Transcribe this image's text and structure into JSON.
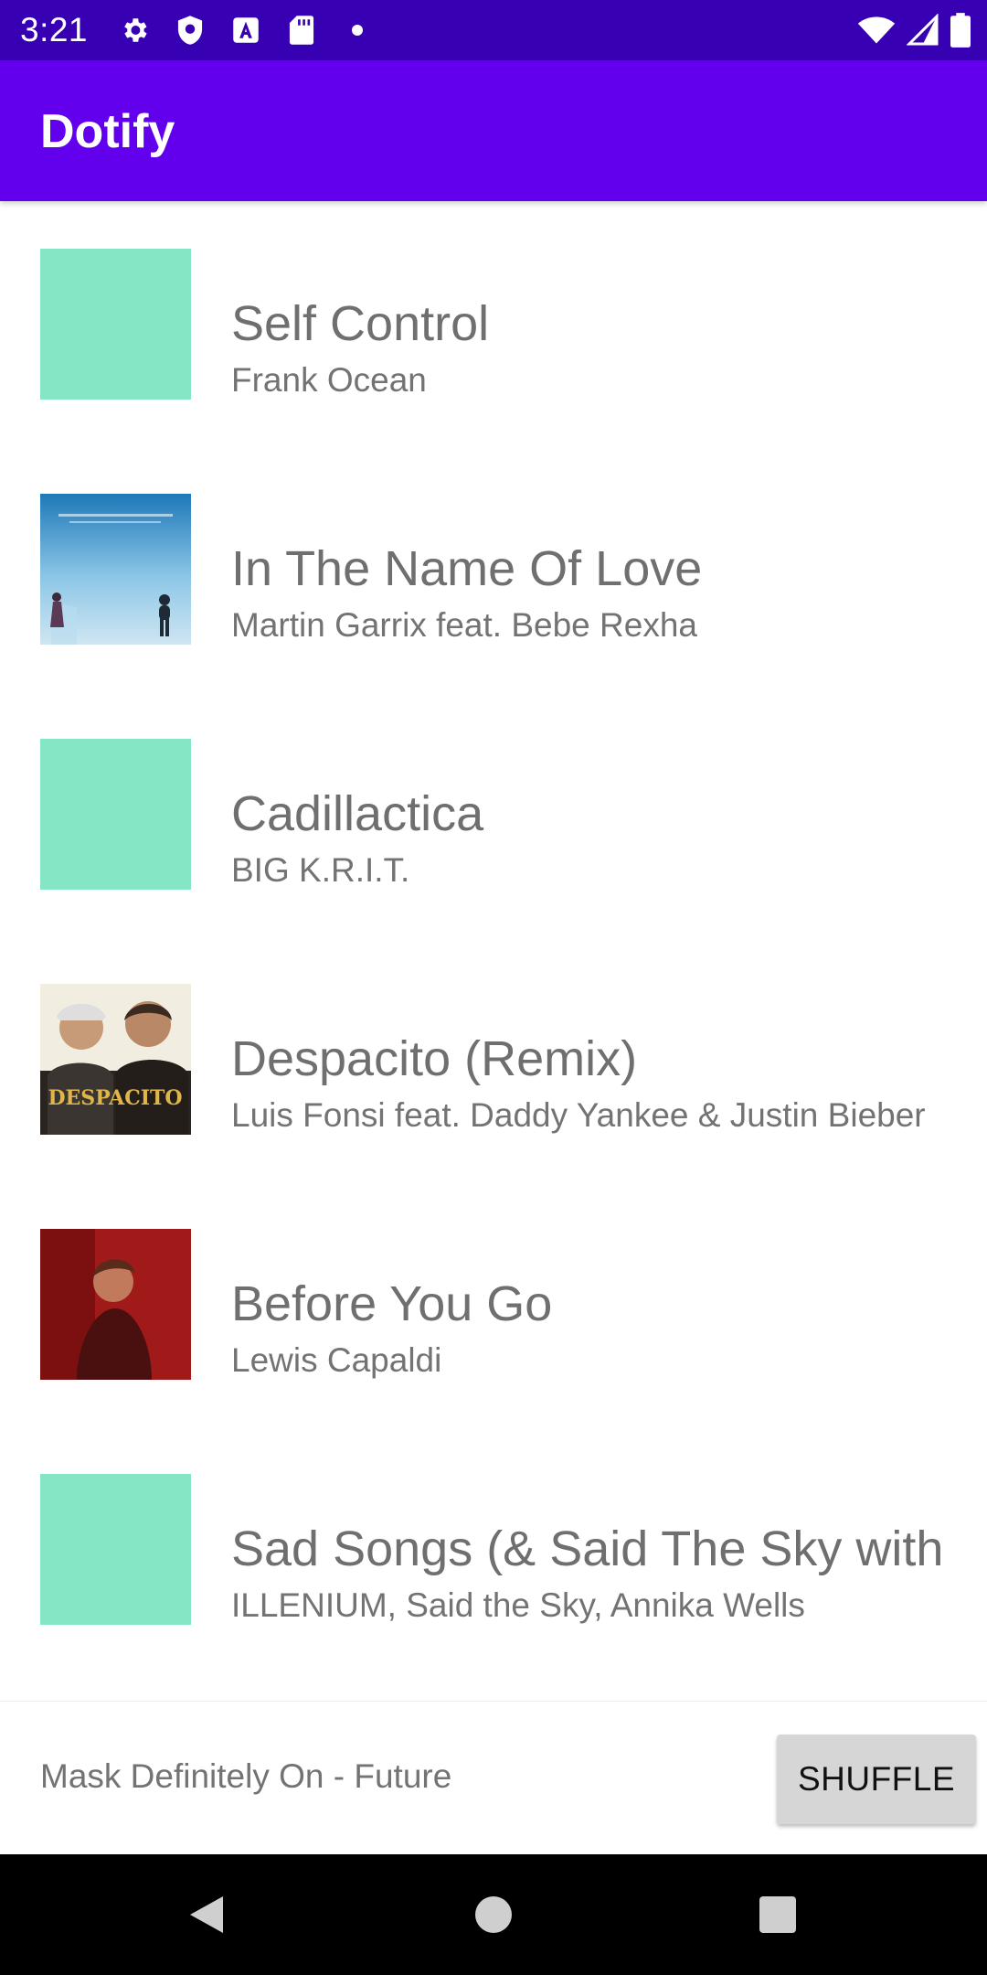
{
  "status_bar": {
    "time": "3:21",
    "left_icons": [
      "settings-icon",
      "shield-icon",
      "a-letter-icon",
      "sd-card-icon",
      "dot-icon"
    ],
    "right_icons": [
      "wifi-icon",
      "signal-icon",
      "battery-icon"
    ],
    "background": "#3700b3"
  },
  "app_bar": {
    "title": "Dotify",
    "background": "#6200ee"
  },
  "songs": [
    {
      "title": "Self Control",
      "artist": "Frank Ocean",
      "cover": "placeholder"
    },
    {
      "title": "In The Name Of Love",
      "artist": "Martin Garrix feat. Bebe Rexha",
      "cover": "album-art-sky"
    },
    {
      "title": "Cadillactica",
      "artist": "BIG K.R.I.T.",
      "cover": "placeholder"
    },
    {
      "title": "Despacito (Remix)",
      "artist": "Luis Fonsi feat. Daddy Yankee & Justin Bieber",
      "cover": "album-art-despacito",
      "cover_text": "DESPACITO"
    },
    {
      "title": "Before You Go",
      "artist": "Lewis Capaldi",
      "cover": "album-art-red"
    },
    {
      "title": "Sad Songs (& Said The Sky with",
      "artist": "ILLENIUM, Said the Sky, Annika Wells",
      "cover": "placeholder"
    }
  ],
  "placeholder_color": "#84e6c4",
  "mini_player": {
    "now_playing": "Mask Definitely On - Future",
    "shuffle_label": "SHUFFLE"
  },
  "nav_bar": {
    "buttons": [
      "back-icon",
      "home-icon",
      "recents-icon"
    ]
  }
}
